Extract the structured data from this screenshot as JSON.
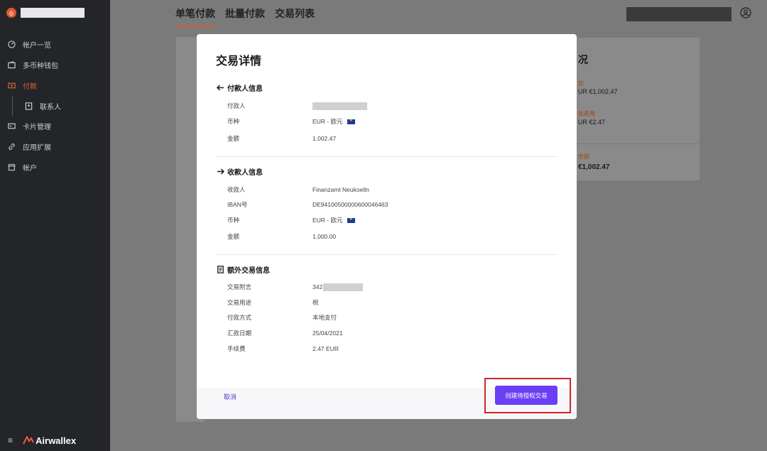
{
  "app": {
    "brand_logo_text": "◎",
    "footer_logo": "Airwallex",
    "hamburger": "≡"
  },
  "sidebar": {
    "items": [
      {
        "label": "帐户一览",
        "icon": "dashboard-icon",
        "active": false
      },
      {
        "label": "多币种钱包",
        "icon": "wallet-icon",
        "active": false
      },
      {
        "label": "付款",
        "icon": "payment-icon",
        "active": true
      },
      {
        "label": "联系人",
        "icon": "contact-icon",
        "active": false,
        "sub": true
      },
      {
        "label": "卡片管理",
        "icon": "card-icon",
        "active": false
      },
      {
        "label": "应用扩展",
        "icon": "link-icon",
        "active": false
      },
      {
        "label": "帐户",
        "icon": "store-icon",
        "active": false
      }
    ]
  },
  "tabs": [
    {
      "label": "单笔付款",
      "active": true
    },
    {
      "label": "批量付款",
      "active": false
    },
    {
      "label": "交易列表",
      "active": false
    }
  ],
  "summary": {
    "title": "况",
    "items": [
      {
        "label": "款",
        "value": "UR €1,002.47"
      },
      {
        "label": "款费用",
        "value": "UR €2.47"
      }
    ],
    "total_label": "金额",
    "total_value": "€1,002.47"
  },
  "modal": {
    "title": "交易详情",
    "payer": {
      "heading": "付款人信息",
      "rows": [
        {
          "key": "付款人",
          "value": ""
        },
        {
          "key": "币种",
          "value": "EUR - 欧元"
        },
        {
          "key": "金额",
          "value": "1,002.47"
        }
      ]
    },
    "payee": {
      "heading": "收款人信息",
      "rows": [
        {
          "key": "收款人",
          "value": "Finanzamt Neukoelln"
        },
        {
          "key": "IBAN号",
          "value": "DE94100500000600046463"
        },
        {
          "key": "币种",
          "value": "EUR - 欧元"
        },
        {
          "key": "金额",
          "value": "1,000.00"
        }
      ]
    },
    "extra": {
      "heading": "额外交易信息",
      "rows": [
        {
          "key": "交易附言",
          "value": "342"
        },
        {
          "key": "交易用途",
          "value": "税"
        },
        {
          "key": "付款方式",
          "value": "本地支付"
        },
        {
          "key": "汇款日期",
          "value": "25/04/2021"
        },
        {
          "key": "手续费",
          "value": "2.47 EUR"
        }
      ]
    },
    "cancel_label": "取消",
    "confirm_label": "创建待授权交易"
  },
  "colors": {
    "accent": "#e0582e",
    "primary": "#6a3ff5",
    "highlight": "#d0252b",
    "sidebar_bg": "#232529"
  }
}
